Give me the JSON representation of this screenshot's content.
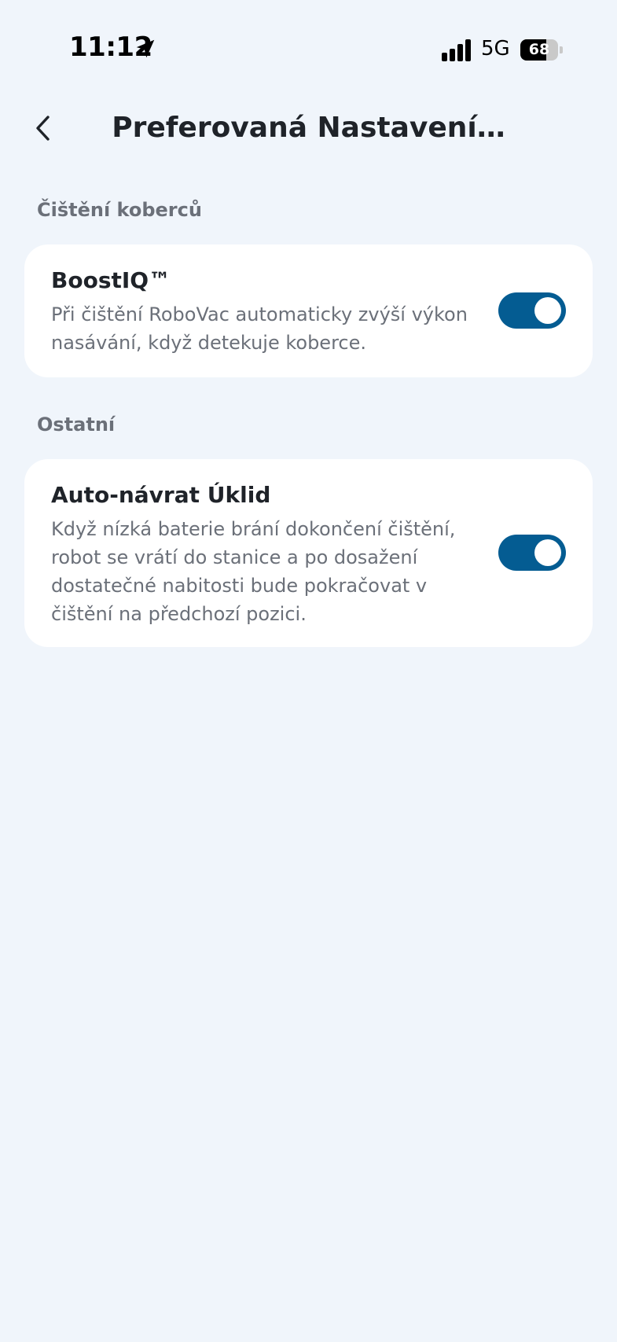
{
  "status_bar": {
    "time": "11:12",
    "network": "5G",
    "battery_percent": "68",
    "battery_level": 0.68,
    "icons": [
      "location-arrow-icon",
      "signal-bars-icon",
      "battery-icon"
    ]
  },
  "header": {
    "title": "Preferovaná Nastavení…",
    "back_icon": "chevron-left-icon"
  },
  "sections": [
    {
      "title": "Čištění koberců",
      "items": [
        {
          "title": "BoostIQ™",
          "description": "Při čištění RoboVac automaticky zvýší výkon nasávání, když detekuje koberce.",
          "enabled": true
        }
      ]
    },
    {
      "title": "Ostatní",
      "items": [
        {
          "title": "Auto-návrat Úklid",
          "description": "Když nízká baterie brání dokončení čištění, robot se vrátí do stanice a po dosažení dostatečné nabitosti bude pokračovat v čištění na předchozí pozici.",
          "enabled": true
        }
      ]
    }
  ],
  "colors": {
    "background": "#f0f5fb",
    "card": "#ffffff",
    "toggle_on": "#045c92",
    "text_primary": "#1f2329",
    "text_secondary": "#6b7079"
  }
}
